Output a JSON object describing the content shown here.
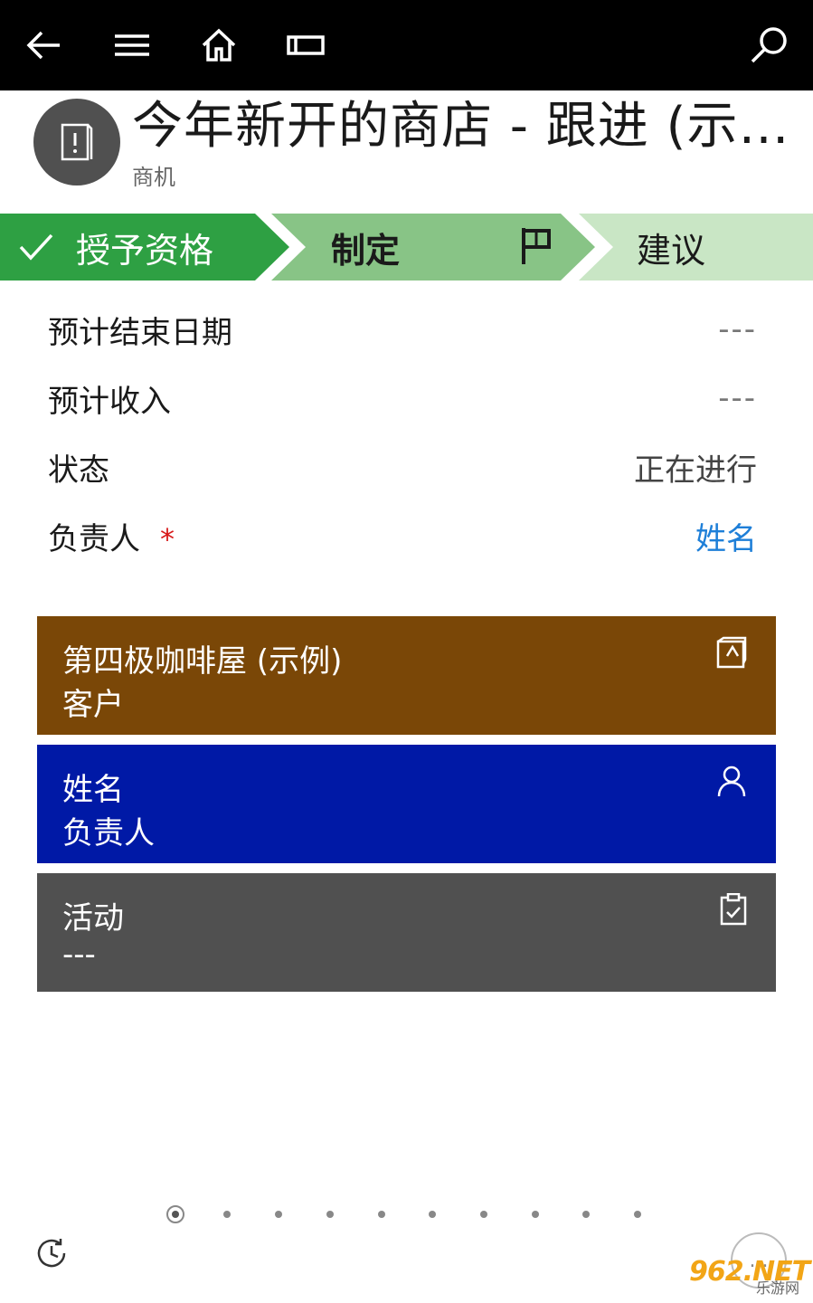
{
  "nav": {
    "icons": [
      "back-arrow-icon",
      "menu-icon",
      "home-icon",
      "window-icon",
      "search-icon"
    ]
  },
  "header": {
    "title": "今年新开的商店 - 跟进 (示例)",
    "subtitle": "商机",
    "avatar_icon": "opportunity-icon"
  },
  "stages": [
    {
      "label": "授予资格",
      "status": "completed",
      "color": "#2ea043"
    },
    {
      "label": "制定",
      "status": "active",
      "color": "#88c486"
    },
    {
      "label": "建议",
      "status": "upcoming",
      "color": "#c9e6c5"
    }
  ],
  "fields": [
    {
      "label": "预计结束日期",
      "value": "---"
    },
    {
      "label": "预计收入",
      "value": "---"
    },
    {
      "label": "状态",
      "value": "正在进行"
    },
    {
      "label": "负责人",
      "required_mark": "*",
      "value": "姓名"
    }
  ],
  "tiles": [
    {
      "title": "第四极咖啡屋 (示例)",
      "subtitle": "客户",
      "color": "#7a4707",
      "icon": "account-icon"
    },
    {
      "title": "姓名",
      "subtitle": "负责人",
      "color": "#0019a6",
      "icon": "person-icon"
    },
    {
      "title": "活动",
      "subtitle": "---",
      "color": "#505050",
      "icon": "clipboard-icon"
    }
  ],
  "pager": {
    "count": 10,
    "active_index": 0
  },
  "footer": {
    "more_label": "...",
    "watermark_main": "962.NET",
    "watermark_sub": "乐游网"
  }
}
